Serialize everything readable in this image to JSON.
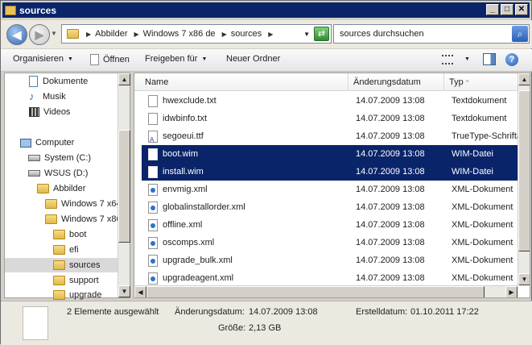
{
  "window": {
    "title": "sources",
    "buttons": {
      "minimize": "_",
      "maximize": "□",
      "close": "✕"
    }
  },
  "address": {
    "crumbs": [
      "Abbilder",
      "Windows 7 x86 de",
      "sources"
    ],
    "search_placeholder": "sources durchsuchen"
  },
  "toolbar": {
    "organize": "Organisieren",
    "open": "Öffnen",
    "share": "Freigeben für",
    "new_folder": "Neuer Ordner"
  },
  "nav": {
    "items": [
      {
        "label": "Dokumente",
        "icon": "document-library-icon"
      },
      {
        "label": "Musik",
        "icon": "music-library-icon"
      },
      {
        "label": "Videos",
        "icon": "video-library-icon"
      },
      {
        "label": "Computer",
        "icon": "computer-icon"
      },
      {
        "label": "System (C:)",
        "icon": "system-drive-icon"
      },
      {
        "label": "WSUS (D:)",
        "icon": "drive-icon"
      },
      {
        "label": "Abbilder",
        "icon": "folder-icon"
      },
      {
        "label": "Windows 7 x64",
        "icon": "folder-icon"
      },
      {
        "label": "Windows 7 x86",
        "icon": "folder-icon"
      },
      {
        "label": "boot",
        "icon": "folder-icon"
      },
      {
        "label": "efi",
        "icon": "folder-icon"
      },
      {
        "label": "sources",
        "icon": "folder-icon"
      },
      {
        "label": "support",
        "icon": "folder-icon"
      },
      {
        "label": "upgrade",
        "icon": "folder-icon"
      }
    ]
  },
  "columns": {
    "name": "Name",
    "date": "Änderungsdatum",
    "type": "Typ",
    "type_sort": "^"
  },
  "files": [
    {
      "name": "hwexclude.txt",
      "date": "14.07.2009 13:08",
      "type": "Textdokument",
      "icon": "text-file-icon"
    },
    {
      "name": "idwbinfo.txt",
      "date": "14.07.2009 13:08",
      "type": "Textdokument",
      "icon": "text-file-icon"
    },
    {
      "name": "segoeui.ttf",
      "date": "14.07.2009 13:08",
      "type": "TrueType-Schriftart",
      "icon": "font-file-icon"
    },
    {
      "name": "boot.wim",
      "date": "14.07.2009 13:08",
      "type": "WIM-Datei",
      "icon": "generic-file-icon",
      "selected": true
    },
    {
      "name": "install.wim",
      "date": "14.07.2009 13:08",
      "type": "WIM-Datei",
      "icon": "generic-file-icon",
      "selected": true
    },
    {
      "name": "envmig.xml",
      "date": "14.07.2009 13:08",
      "type": "XML-Dokument",
      "icon": "xml-file-icon"
    },
    {
      "name": "globalinstallorder.xml",
      "date": "14.07.2009 13:08",
      "type": "XML-Dokument",
      "icon": "xml-file-icon"
    },
    {
      "name": "offline.xml",
      "date": "14.07.2009 13:08",
      "type": "XML-Dokument",
      "icon": "xml-file-icon"
    },
    {
      "name": "oscomps.xml",
      "date": "14.07.2009 13:08",
      "type": "XML-Dokument",
      "icon": "xml-file-icon"
    },
    {
      "name": "upgrade_bulk.xml",
      "date": "14.07.2009 13:08",
      "type": "XML-Dokument",
      "icon": "xml-file-icon"
    },
    {
      "name": "upgradeagent.xml",
      "date": "14.07.2009 13:08",
      "type": "XML-Dokument",
      "icon": "xml-file-icon"
    }
  ],
  "status": {
    "selection": "2 Elemente ausgewählt",
    "modified_label": "Änderungsdatum:",
    "modified_value": "14.07.2009 13:08",
    "created_label": "Erstelldatum:",
    "created_value": "01.10.2011 17:22",
    "size_label": "Größe:",
    "size_value": "2,13 GB"
  },
  "colors": {
    "titlebar": "#0a246a",
    "selection": "#0a246a"
  }
}
